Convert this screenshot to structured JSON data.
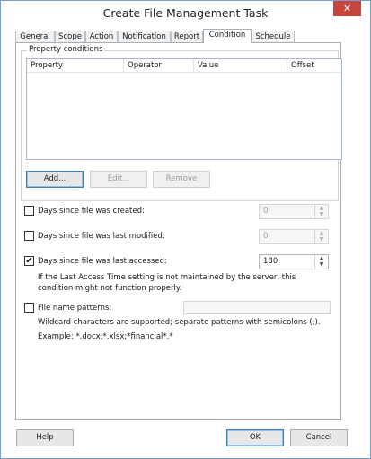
{
  "window": {
    "title": "Create File Management Task",
    "close_glyph": "✕"
  },
  "tabs": [
    {
      "label": "General"
    },
    {
      "label": "Scope"
    },
    {
      "label": "Action"
    },
    {
      "label": "Notification"
    },
    {
      "label": "Report"
    },
    {
      "label": "Condition",
      "active": true
    },
    {
      "label": "Schedule"
    }
  ],
  "property_conditions": {
    "group_label": "Property conditions",
    "columns": [
      "Property",
      "Operator",
      "Value",
      "Offset"
    ],
    "rows": [],
    "add_label": "Add...",
    "edit_label": "Edit...",
    "remove_label": "Remove"
  },
  "conditions": {
    "created": {
      "label": "Days since file was created:",
      "checked": false,
      "value": "0"
    },
    "modified": {
      "label": "Days since file was last modified:",
      "checked": false,
      "value": "0"
    },
    "accessed": {
      "label": "Days since file was last accessed:",
      "checked": true,
      "value": "180",
      "note_line1": "If the Last Access Time setting is not maintained by the server, this",
      "note_line2": "condition might not function properly."
    },
    "patterns": {
      "label": "File name patterns:",
      "checked": false,
      "value": "",
      "hint_line1": "Wildcard characters are supported; separate patterns with semicolons (;).",
      "hint_line2": "Example: *.docx;*.xlsx;*financial*.*"
    }
  },
  "footer": {
    "help_label": "Help",
    "ok_label": "OK",
    "cancel_label": "Cancel"
  },
  "glyphs": {
    "check": "✔",
    "up": "▲",
    "down": "▼"
  }
}
